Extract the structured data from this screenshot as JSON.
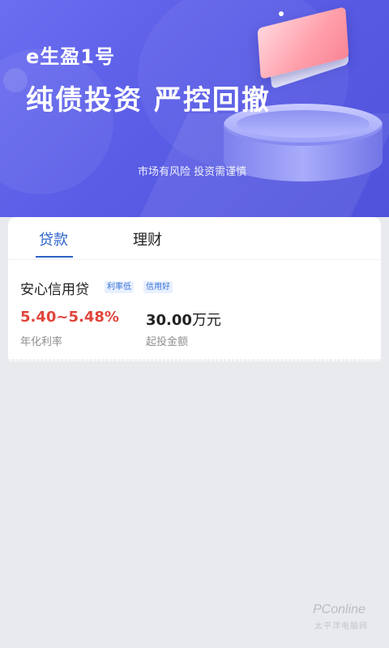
{
  "banner": {
    "brand": "e生盈1号",
    "headline": "纯债投资 严控回撤",
    "risk_note": "市场有风险 投资需谨慎",
    "colors": {
      "background": "#5a5de6",
      "accent": "#ff9eaa"
    }
  },
  "tabs": [
    {
      "label": "贷款",
      "active": true
    },
    {
      "label": "理财",
      "active": false
    }
  ],
  "product": {
    "name": "安心信用贷",
    "tags": [
      "利率低",
      "信用好"
    ],
    "rate": "5.40~5.48%",
    "rate_label": "年化利率",
    "amount": "30.00",
    "amount_unit": "万元",
    "amount_label": "起投金额"
  },
  "colors": {
    "tab_active": "#2a62c9",
    "rate": "#e0453b"
  },
  "watermark": {
    "text": "PConline",
    "sub": "太平洋电脑网"
  }
}
